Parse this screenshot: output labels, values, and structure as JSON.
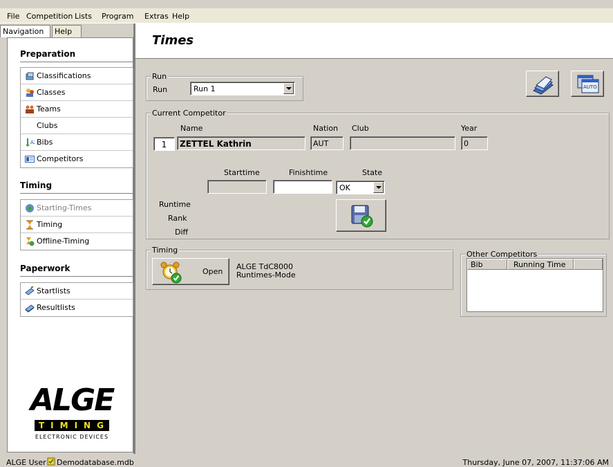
{
  "menu": [
    "File",
    "Competition",
    "Lists",
    "Program",
    "Extras",
    "Help"
  ],
  "nav_tabs": [
    "Navigation",
    "Help"
  ],
  "sections": {
    "preparation": {
      "title": "Preparation",
      "items": [
        {
          "label": "Classifications",
          "icon": "classifications-icon"
        },
        {
          "label": "Classes",
          "icon": "classes-icon"
        },
        {
          "label": "Teams",
          "icon": "teams-icon"
        },
        {
          "label": "Clubs",
          "icon": ""
        },
        {
          "label": "Bibs",
          "icon": "bibs-icon"
        },
        {
          "label": "Competitors",
          "icon": "competitors-icon"
        }
      ]
    },
    "timing": {
      "title": "Timing",
      "items": [
        {
          "label": "Starting-Times",
          "icon": "starting-times-icon",
          "disabled": true
        },
        {
          "label": "Timing",
          "icon": "timing-icon"
        },
        {
          "label": "Offline-Timing",
          "icon": "offline-timing-icon"
        }
      ]
    },
    "paperwork": {
      "title": "Paperwork",
      "items": [
        {
          "label": "Startlists",
          "icon": "startlists-icon"
        },
        {
          "label": "Resultlists",
          "icon": "resultlists-icon"
        }
      ]
    }
  },
  "logo": {
    "brand": "ALGE",
    "timing": "TIMING",
    "tagline": "ELECTRONIC DEVICES"
  },
  "page_title": "Times",
  "run_group": {
    "legend": "Run",
    "label": "Run",
    "selected": "Run 1"
  },
  "toolbar": {
    "auto_label": "AUTO"
  },
  "competitor": {
    "legend": "Current Competitor",
    "name_header": "Name",
    "nation_header": "Nation",
    "club_header": "Club",
    "year_header": "Year",
    "bib": "1",
    "name": "ZETTEL Kathrin",
    "nation": "AUT",
    "club": "",
    "year": "0",
    "starttime_label": "Starttime",
    "finishtime_label": "Finishtime",
    "state_label": "State",
    "starttime": "",
    "finishtime": "",
    "state": "OK",
    "runtime_label": "Runtime",
    "rank_label": "Rank",
    "diff_label": "Diff"
  },
  "timing_group": {
    "legend": "Timing",
    "open_label": "Open",
    "device": "ALGE TdC8000",
    "mode": "Runtimes-Mode"
  },
  "other_competitors": {
    "legend": "Other Competitors",
    "columns": [
      "Bib",
      "Running Time",
      ""
    ]
  },
  "status": {
    "user": "ALGE User",
    "database": "Demodatabase.mdb",
    "datetime": "Thursday, June 07, 2007, 11:37:06 AM"
  }
}
